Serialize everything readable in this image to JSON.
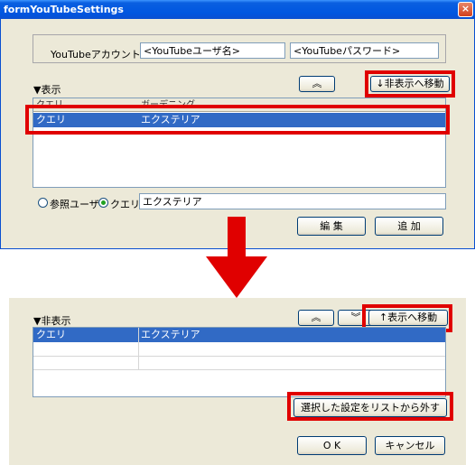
{
  "window": {
    "title": "formYouTubeSettings",
    "close_glyph": "×"
  },
  "account": {
    "label": "YouTubeアカウント",
    "username_value": "<YouTubeユーザ名>",
    "password_value": "<YouTubeパスワード>"
  },
  "visible_section": {
    "header": "▼表示",
    "up_button": "︽",
    "move_hidden_button": "↓非表示へ移動",
    "columns": [
      "クエリ",
      "ガーデニング"
    ],
    "rows": [
      {
        "type": "クエリ",
        "value": "エクステリア",
        "selected": true
      }
    ],
    "radio_user_label": "参照ユーザ",
    "radio_query_label": "クエリ",
    "radio_selected": "query",
    "input_value": "エクステリア",
    "edit_button": "編 集",
    "add_button": "追 加"
  },
  "hidden_section": {
    "header": "▼非表示",
    "up_button": "︽",
    "down_button": "︾",
    "move_visible_button": "↑表示へ移動",
    "rows": [
      {
        "type": "クエリ",
        "value": "エクステリア",
        "selected": true
      }
    ],
    "remove_button": "選択した設定をリストから外す",
    "ok_button": "O K",
    "cancel_button": "キャンセル"
  },
  "colors": {
    "highlight": "#e00000",
    "selection": "#316ac5",
    "arrow": "#e00000"
  }
}
